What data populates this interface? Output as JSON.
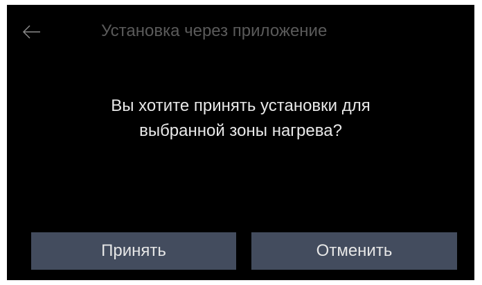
{
  "header": {
    "back_icon": "arrow-left-icon",
    "title": "Установка через приложение"
  },
  "dialog": {
    "message_line1": "Вы хотите принять установки для",
    "message_line2": "выбранной зоны нагрева?"
  },
  "buttons": {
    "accept_label": "Принять",
    "cancel_label": "Отменить"
  },
  "colors": {
    "background": "#000000",
    "title_text": "#5a5a5a",
    "message_text": "#e9e9e9",
    "button_bg": "#434c5e",
    "button_text": "#e6e6e6"
  }
}
